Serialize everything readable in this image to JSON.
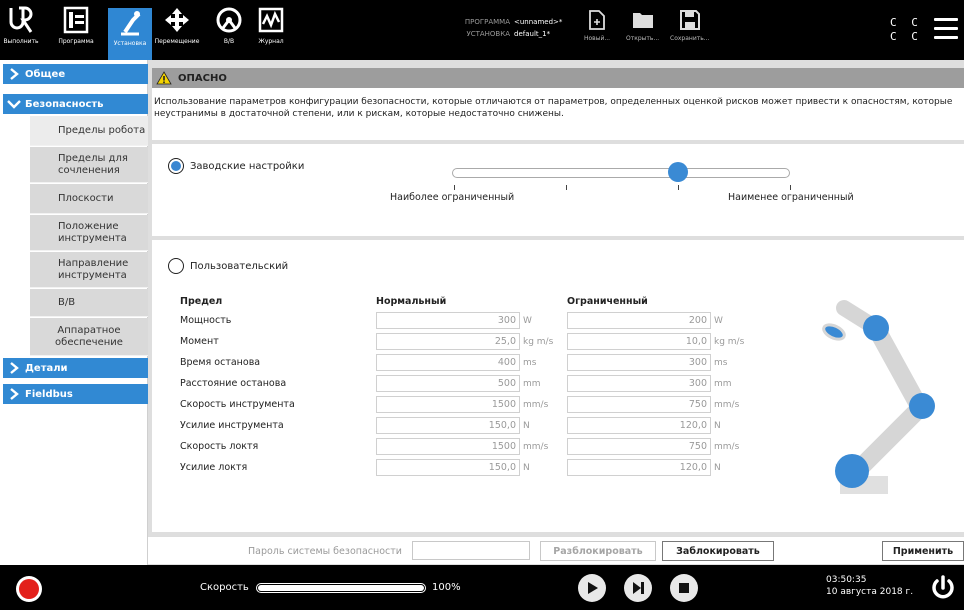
{
  "topbar": {
    "buttons": [
      {
        "label": "Выполнить",
        "icon": "ur-logo-icon"
      },
      {
        "label": "Программа",
        "icon": "program-icon"
      },
      {
        "label": "Установка",
        "icon": "installation-icon",
        "active": true
      },
      {
        "label": "Перемещение",
        "icon": "move-icon"
      },
      {
        "label": "В/В",
        "icon": "io-icon"
      },
      {
        "label": "Журнал",
        "icon": "log-icon"
      }
    ],
    "program_key": "ПРОГРАММА",
    "program_value": "<unnamed>*",
    "installation_key": "УСТАНОВКА",
    "installation_value": "default_1*",
    "file_new": "Новый...",
    "file_open": "Открыть...",
    "file_save": "Сохранить...",
    "cc_line1": "C C",
    "cc_line2": "C C",
    "accent_color": "#2f87d3"
  },
  "sidebar": {
    "general": "Общее",
    "safety": "Безопасность",
    "items": [
      "Пределы робота",
      "Пределы для сочленения",
      "Плоскости",
      "Положение инструмента",
      "Направление инструмента",
      "В/В",
      "Аппаратное обеспечение"
    ],
    "details": "Детали",
    "fieldbus": "Fieldbus"
  },
  "main": {
    "danger_title": "ОПАСНО",
    "warning_text": "Использование параметров конфигурации безопасности, которые отличаются от параметров, определенных оценкой рисков может привести к опасностям, которые неустранимы в достаточной степени, или к рискам, которые недостаточно снижены.",
    "factory_label": "Заводские настройки",
    "factory_selected": true,
    "slider_left_label": "Наиболее ограниченный",
    "slider_right_label": "Наименее ограниченный",
    "slider_position": 0.67,
    "custom_label": "Пользовательский",
    "custom_selected": false,
    "limits_headers": [
      "Предел",
      "Нормальный",
      "Ограниченный"
    ],
    "limits": [
      {
        "name": "Мощность",
        "normal": "300",
        "normal_unit": "W",
        "reduced": "200",
        "reduced_unit": "W"
      },
      {
        "name": "Момент",
        "normal": "25,0",
        "normal_unit": "kg m/s",
        "reduced": "10,0",
        "reduced_unit": "kg m/s"
      },
      {
        "name": "Время останова",
        "normal": "400",
        "normal_unit": "ms",
        "reduced": "300",
        "reduced_unit": "ms"
      },
      {
        "name": "Расстояние останова",
        "normal": "500",
        "normal_unit": "mm",
        "reduced": "300",
        "reduced_unit": "mm"
      },
      {
        "name": "Скорость инструмента",
        "normal": "1500",
        "normal_unit": "mm/s",
        "reduced": "750",
        "reduced_unit": "mm/s"
      },
      {
        "name": "Усилие инструмента",
        "normal": "150,0",
        "normal_unit": "N",
        "reduced": "120,0",
        "reduced_unit": "N"
      },
      {
        "name": "Скорость локтя",
        "normal": "1500",
        "normal_unit": "mm/s",
        "reduced": "750",
        "reduced_unit": "mm/s"
      },
      {
        "name": "Усилие локтя",
        "normal": "150,0",
        "normal_unit": "N",
        "reduced": "120,0",
        "reduced_unit": "N"
      }
    ],
    "password_label": "Пароль системы безопасности",
    "password_value": "",
    "unlock_button": "Разблокировать",
    "lock_button": "Заблокировать",
    "apply_button": "Применить"
  },
  "footer": {
    "speed_label": "Скорость",
    "speed_value": "100%",
    "speed_fraction": 1.0,
    "time": "03:50:35",
    "date": "10 августа 2018 г."
  }
}
